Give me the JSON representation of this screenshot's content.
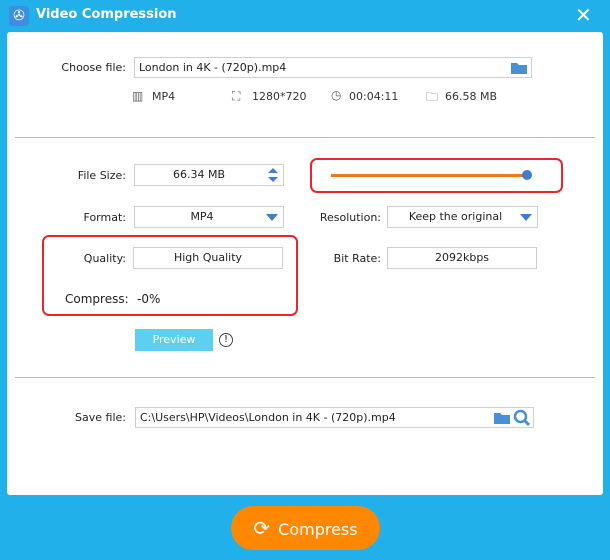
{
  "window": {
    "title": "Video Compression",
    "close_icon": "close-icon",
    "app_icon": "film-reel-icon"
  },
  "source": {
    "label": "Choose file:",
    "value": "London in 4K - (720p).mp4",
    "format": "MP4",
    "resolution": "1280*720",
    "duration": "00:04:11",
    "size": "66.58 MB"
  },
  "settings": {
    "file_size_label": "File Size:",
    "file_size_value": "66.34 MB",
    "slider_percent": 100,
    "format_label": "Format:",
    "format_value": "MP4",
    "resolution_label": "Resolution:",
    "resolution_value": "Keep the original",
    "quality_label": "Quality:",
    "quality_value": "High Quality",
    "bitrate_label": "Bit Rate:",
    "bitrate_value": "2092kbps",
    "compress_label": "Compress:",
    "compress_value": "-0%",
    "preview_label": "Preview"
  },
  "output": {
    "label": "Save file:",
    "value": "C:\\Users\\HP\\Videos\\London in 4K - (720p).mp4"
  },
  "compress_button": "Compress",
  "colors": {
    "frame": "#22b0ea",
    "accent": "#ff8800",
    "highlight": "#e8262d",
    "slider": "#f07a1a",
    "knob": "#3a7fd5"
  }
}
